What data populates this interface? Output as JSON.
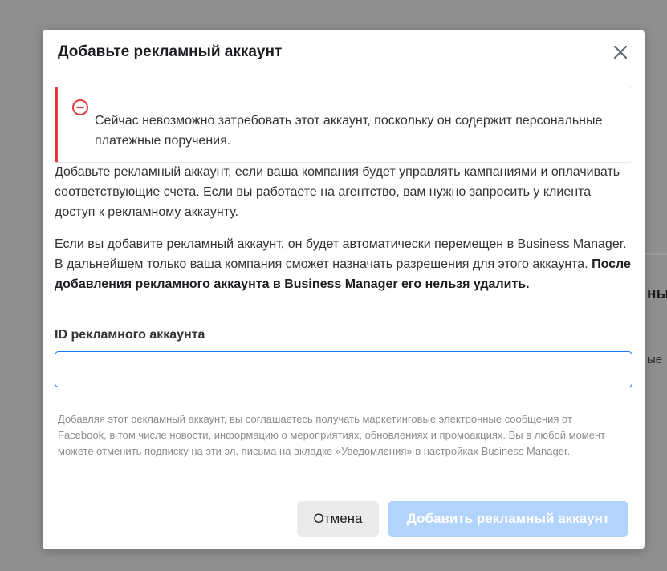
{
  "background": {
    "fragment_1": "ны",
    "fragment_2": "ые"
  },
  "modal": {
    "title": "Добавьте рекламный аккаунт",
    "close_icon": "close-icon",
    "alert": {
      "icon": "minus-circle-icon",
      "color": "#e0393e",
      "text": "Сейчас невозможно затребовать этот аккаунт, поскольку он содержит персональные платежные поручения."
    },
    "paragraph_1": "Добавьте рекламный аккаунт, если ваша компания будет управлять кампаниями и оплачивать соответствующие счета. Если вы работаете на агентство, вам нужно запросить у клиента доступ к рекламному аккаунту.",
    "paragraph_2_normal": "Если вы добавите рекламный аккаунт, он будет автоматически перемещен в Business Manager. В дальнейшем только ваша компания сможет назначать разрешения для этого аккаунта. ",
    "paragraph_2_bold": "После добавления рекламного аккаунта в Business Manager его нельзя удалить.",
    "field_label": "ID рекламного аккаунта",
    "field_value": "",
    "field_placeholder": "",
    "disclaimer": "Добавляя этот рекламный аккаунт, вы соглашаетесь получать маркетинговые электронные сообщения от Facebook, в том числе новости, информацию о мероприятиях, обновлениях и промоакциях. Вы в любой момент можете отменить подписку на эти эл. письма на вкладке «Уведомления» в настройках Business Manager.",
    "cancel_label": "Отмена",
    "submit_label": "Добавить рекламный аккаунт",
    "accent_color": "#1877f2",
    "submit_disabled_color": "#b2d3fb"
  }
}
